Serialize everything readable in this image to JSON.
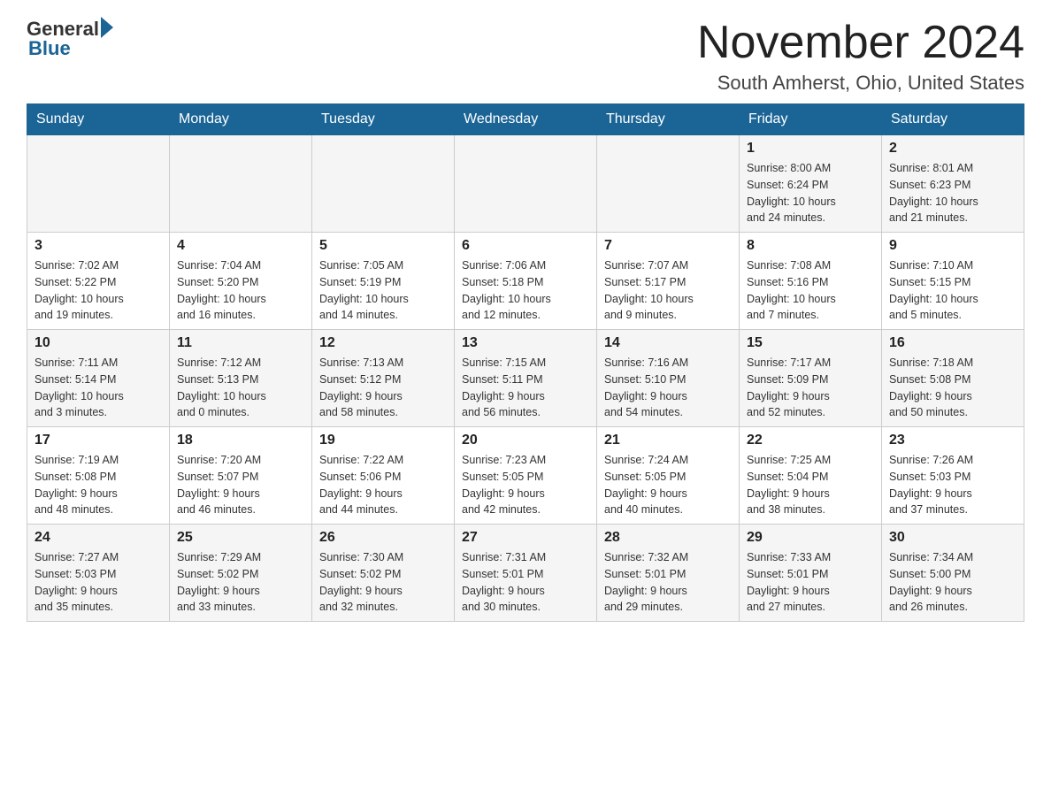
{
  "header": {
    "logo": {
      "general": "General",
      "blue": "Blue"
    },
    "title": "November 2024",
    "location": "South Amherst, Ohio, United States"
  },
  "calendar": {
    "days_of_week": [
      "Sunday",
      "Monday",
      "Tuesday",
      "Wednesday",
      "Thursday",
      "Friday",
      "Saturday"
    ],
    "weeks": [
      [
        {
          "day": "",
          "info": ""
        },
        {
          "day": "",
          "info": ""
        },
        {
          "day": "",
          "info": ""
        },
        {
          "day": "",
          "info": ""
        },
        {
          "day": "",
          "info": ""
        },
        {
          "day": "1",
          "info": "Sunrise: 8:00 AM\nSunset: 6:24 PM\nDaylight: 10 hours\nand 24 minutes."
        },
        {
          "day": "2",
          "info": "Sunrise: 8:01 AM\nSunset: 6:23 PM\nDaylight: 10 hours\nand 21 minutes."
        }
      ],
      [
        {
          "day": "3",
          "info": "Sunrise: 7:02 AM\nSunset: 5:22 PM\nDaylight: 10 hours\nand 19 minutes."
        },
        {
          "day": "4",
          "info": "Sunrise: 7:04 AM\nSunset: 5:20 PM\nDaylight: 10 hours\nand 16 minutes."
        },
        {
          "day": "5",
          "info": "Sunrise: 7:05 AM\nSunset: 5:19 PM\nDaylight: 10 hours\nand 14 minutes."
        },
        {
          "day": "6",
          "info": "Sunrise: 7:06 AM\nSunset: 5:18 PM\nDaylight: 10 hours\nand 12 minutes."
        },
        {
          "day": "7",
          "info": "Sunrise: 7:07 AM\nSunset: 5:17 PM\nDaylight: 10 hours\nand 9 minutes."
        },
        {
          "day": "8",
          "info": "Sunrise: 7:08 AM\nSunset: 5:16 PM\nDaylight: 10 hours\nand 7 minutes."
        },
        {
          "day": "9",
          "info": "Sunrise: 7:10 AM\nSunset: 5:15 PM\nDaylight: 10 hours\nand 5 minutes."
        }
      ],
      [
        {
          "day": "10",
          "info": "Sunrise: 7:11 AM\nSunset: 5:14 PM\nDaylight: 10 hours\nand 3 minutes."
        },
        {
          "day": "11",
          "info": "Sunrise: 7:12 AM\nSunset: 5:13 PM\nDaylight: 10 hours\nand 0 minutes."
        },
        {
          "day": "12",
          "info": "Sunrise: 7:13 AM\nSunset: 5:12 PM\nDaylight: 9 hours\nand 58 minutes."
        },
        {
          "day": "13",
          "info": "Sunrise: 7:15 AM\nSunset: 5:11 PM\nDaylight: 9 hours\nand 56 minutes."
        },
        {
          "day": "14",
          "info": "Sunrise: 7:16 AM\nSunset: 5:10 PM\nDaylight: 9 hours\nand 54 minutes."
        },
        {
          "day": "15",
          "info": "Sunrise: 7:17 AM\nSunset: 5:09 PM\nDaylight: 9 hours\nand 52 minutes."
        },
        {
          "day": "16",
          "info": "Sunrise: 7:18 AM\nSunset: 5:08 PM\nDaylight: 9 hours\nand 50 minutes."
        }
      ],
      [
        {
          "day": "17",
          "info": "Sunrise: 7:19 AM\nSunset: 5:08 PM\nDaylight: 9 hours\nand 48 minutes."
        },
        {
          "day": "18",
          "info": "Sunrise: 7:20 AM\nSunset: 5:07 PM\nDaylight: 9 hours\nand 46 minutes."
        },
        {
          "day": "19",
          "info": "Sunrise: 7:22 AM\nSunset: 5:06 PM\nDaylight: 9 hours\nand 44 minutes."
        },
        {
          "day": "20",
          "info": "Sunrise: 7:23 AM\nSunset: 5:05 PM\nDaylight: 9 hours\nand 42 minutes."
        },
        {
          "day": "21",
          "info": "Sunrise: 7:24 AM\nSunset: 5:05 PM\nDaylight: 9 hours\nand 40 minutes."
        },
        {
          "day": "22",
          "info": "Sunrise: 7:25 AM\nSunset: 5:04 PM\nDaylight: 9 hours\nand 38 minutes."
        },
        {
          "day": "23",
          "info": "Sunrise: 7:26 AM\nSunset: 5:03 PM\nDaylight: 9 hours\nand 37 minutes."
        }
      ],
      [
        {
          "day": "24",
          "info": "Sunrise: 7:27 AM\nSunset: 5:03 PM\nDaylight: 9 hours\nand 35 minutes."
        },
        {
          "day": "25",
          "info": "Sunrise: 7:29 AM\nSunset: 5:02 PM\nDaylight: 9 hours\nand 33 minutes."
        },
        {
          "day": "26",
          "info": "Sunrise: 7:30 AM\nSunset: 5:02 PM\nDaylight: 9 hours\nand 32 minutes."
        },
        {
          "day": "27",
          "info": "Sunrise: 7:31 AM\nSunset: 5:01 PM\nDaylight: 9 hours\nand 30 minutes."
        },
        {
          "day": "28",
          "info": "Sunrise: 7:32 AM\nSunset: 5:01 PM\nDaylight: 9 hours\nand 29 minutes."
        },
        {
          "day": "29",
          "info": "Sunrise: 7:33 AM\nSunset: 5:01 PM\nDaylight: 9 hours\nand 27 minutes."
        },
        {
          "day": "30",
          "info": "Sunrise: 7:34 AM\nSunset: 5:00 PM\nDaylight: 9 hours\nand 26 minutes."
        }
      ]
    ]
  }
}
